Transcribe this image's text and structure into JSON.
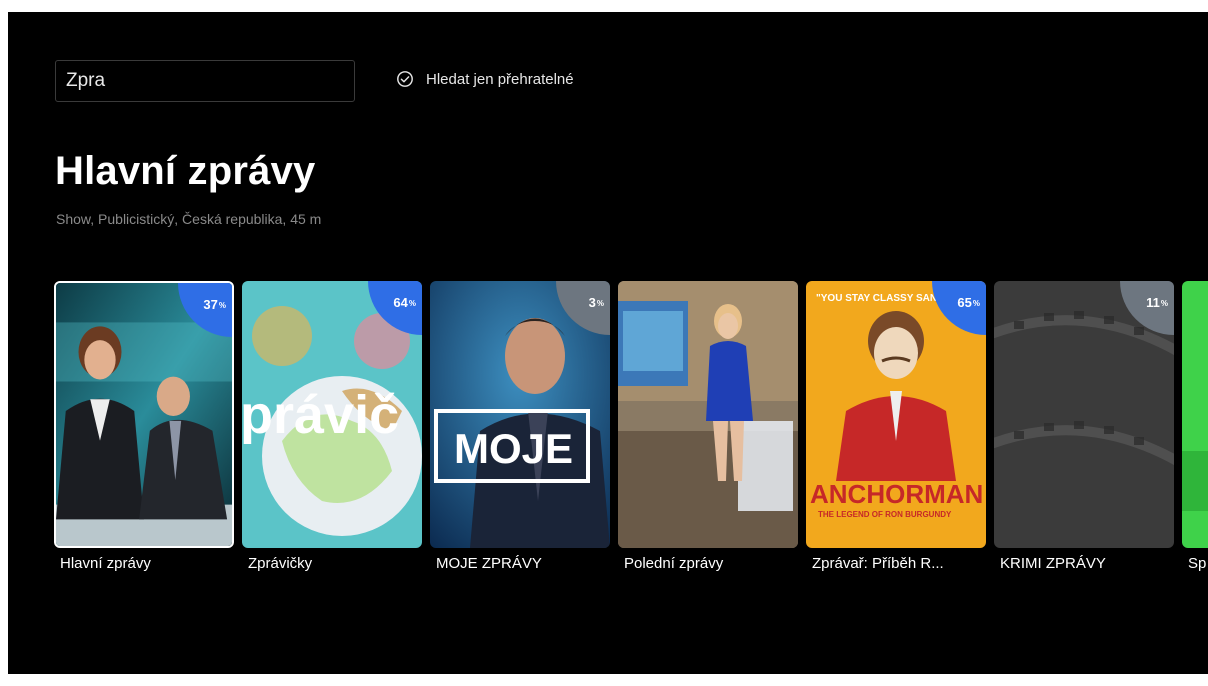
{
  "search": {
    "value": "Zpra",
    "placeholder": ""
  },
  "filter": {
    "label": "Hledat jen přehratelné",
    "icon": "circle-check-icon"
  },
  "detail": {
    "title": "Hlavní zprávy",
    "subtitle": "Show, Publicistický, Česká republika, 45 m"
  },
  "results": [
    {
      "title": "Hlavní zprávy",
      "progress": "37",
      "badge_color": "#2f6ee6",
      "selected": true
    },
    {
      "title": "Zprávičky",
      "progress": "64",
      "badge_color": "#2f6ee6",
      "thumb_text": "právič"
    },
    {
      "title": "MOJE ZPRÁVY",
      "progress": "3",
      "badge_color": "#6d7680",
      "thumb_text": "MOJE"
    },
    {
      "title": "Polední zprávy",
      "progress": "",
      "badge_color": ""
    },
    {
      "title": "Zprávař: Příběh R...",
      "progress": "65",
      "badge_color": "#2f6ee6",
      "thumb_text": "ANCHORMAN",
      "thumb_subtext": "THE LEGEND OF RON BURGUNDY",
      "thumb_top_text": "\"YOU STAY CLASSY SAN"
    },
    {
      "title": "KRIMI ZPRÁVY",
      "progress": "11",
      "badge_color": "#6d7680"
    },
    {
      "title": "Sp",
      "progress": "",
      "badge_color": ""
    }
  ],
  "percent_sign": "%"
}
